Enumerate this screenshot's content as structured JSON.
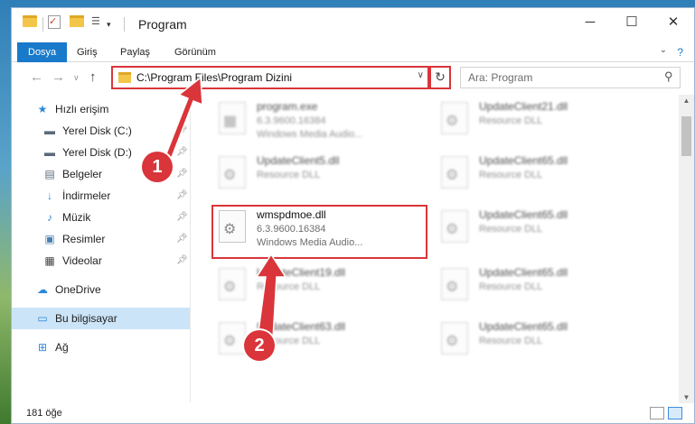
{
  "window": {
    "title": "Program",
    "controls": {
      "minimize": "─",
      "maximize": "☐",
      "close": "✕"
    }
  },
  "ribbon": {
    "tabs": [
      "Dosya",
      "Giriş",
      "Paylaş",
      "Görünüm"
    ],
    "help": "?"
  },
  "address": {
    "path": "C:\\Program Files\\Program Dizini",
    "search_placeholder": "Ara: Program"
  },
  "sidebar": {
    "items": [
      {
        "label": "Hızlı erişim",
        "icon": "star-icon",
        "pinned": false
      },
      {
        "label": "Yerel Disk (C:)",
        "icon": "drive-icon",
        "pinned": true
      },
      {
        "label": "Yerel Disk (D:)",
        "icon": "drive-icon",
        "pinned": true
      },
      {
        "label": "Belgeler",
        "icon": "documents-icon",
        "pinned": true
      },
      {
        "label": "İndirmeler",
        "icon": "download-icon",
        "pinned": true
      },
      {
        "label": "Müzik",
        "icon": "music-icon",
        "pinned": true
      },
      {
        "label": "Resimler",
        "icon": "pictures-icon",
        "pinned": true
      },
      {
        "label": "Videolar",
        "icon": "videos-icon",
        "pinned": true
      },
      {
        "label": "OneDrive",
        "icon": "cloud-icon",
        "pinned": false
      },
      {
        "label": "Bu bilgisayar",
        "icon": "computer-icon",
        "pinned": false
      },
      {
        "label": "Ağ",
        "icon": "network-icon",
        "pinned": false
      }
    ]
  },
  "files": {
    "left": [
      {
        "name": "program.exe",
        "line1": "6.3.9600.16384",
        "line2": "Windows Media Audio..."
      },
      {
        "name": "UpdateClient5.dll",
        "line1": "Resource DLL",
        "line2": ""
      },
      {
        "name": "wmspdmoe.dll",
        "line1": "6.3.9600.16384",
        "line2": "Windows Media Audio..."
      },
      {
        "name": "UpdateClient19.dll",
        "line1": "Resource DLL",
        "line2": ""
      },
      {
        "name": "UpdateClient63.dll",
        "line1": "Resource DLL",
        "line2": ""
      }
    ],
    "right": [
      {
        "name": "UpdateClient21.dll",
        "line1": "Resource DLL"
      },
      {
        "name": "UpdateClient65.dll",
        "line1": "Resource DLL"
      },
      {
        "name": "UpdateClient65.dll",
        "line1": "Resource DLL"
      },
      {
        "name": "UpdateClient65.dll",
        "line1": "Resource DLL"
      },
      {
        "name": "UpdateClient65.dll",
        "line1": "Resource DLL"
      }
    ]
  },
  "status": {
    "count": "181 öğe"
  },
  "annotations": {
    "step1": "1",
    "step2": "2"
  },
  "colors": {
    "accent": "#1979ca",
    "highlight": "#d9353a",
    "selected": "#cce4f7"
  }
}
